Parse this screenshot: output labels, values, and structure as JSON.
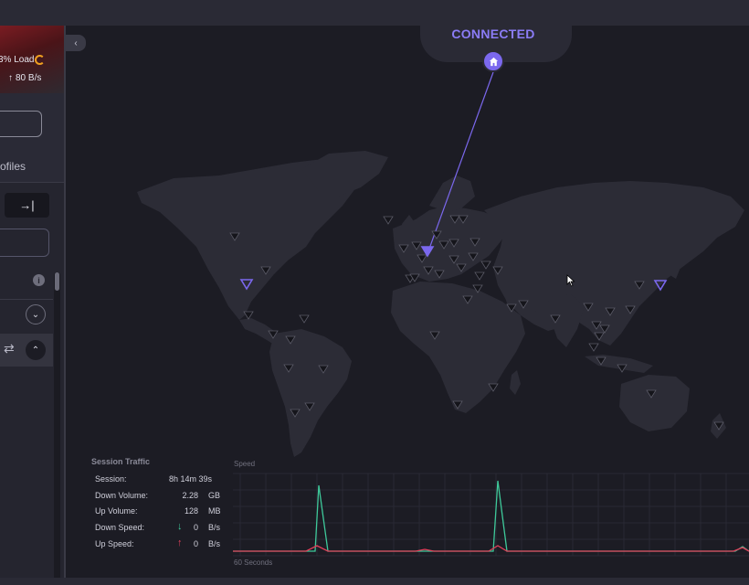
{
  "status": {
    "label": "CONNECTED"
  },
  "sidebar": {
    "load_text": "3% Load",
    "upload_arrow": "↑",
    "upload_speed": "80 B/s",
    "profiles_label": "ofiles",
    "collapse_icon": "→|",
    "info_icon": "i",
    "chevron_down": "⌄",
    "chevron_up": "⌃",
    "swap_icon": "⇄"
  },
  "back_icon": "‹",
  "session_traffic": {
    "title": "Session Traffic",
    "rows": [
      {
        "label": "Session:",
        "value": "8h 14m 39s",
        "arrow": "",
        "unit": ""
      },
      {
        "label": "Down Volume:",
        "value": "2.28",
        "arrow": "",
        "unit": "GB"
      },
      {
        "label": "Up Volume:",
        "value": "128",
        "arrow": "",
        "unit": "MB"
      },
      {
        "label": "Down Speed:",
        "value": "0",
        "arrow": "↓",
        "unit": "B/s"
      },
      {
        "label": "Up Speed:",
        "value": "0",
        "arrow": "↑",
        "unit": "B/s"
      }
    ]
  },
  "speed_chart": {
    "title": "Speed",
    "x_caption": "60 Seconds",
    "down_color": "#3ec99a",
    "up_color": "#e0405a"
  },
  "colors": {
    "accent": "#7b68ee",
    "connected_text": "#8b7cf6",
    "server_marker": "#15151b",
    "active_marker": "#7b68ee"
  }
}
